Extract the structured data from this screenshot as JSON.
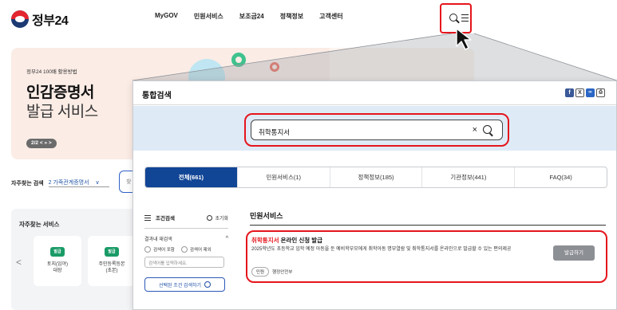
{
  "header": {
    "logo_text": "정부24",
    "menu": [
      "MyGOV",
      "민원서비스",
      "보조금24",
      "정책정보",
      "고객센터"
    ]
  },
  "hero": {
    "small": "정부24 100배 활용방법",
    "title": "인감증명서",
    "subtitle": "발급 서비스",
    "pager": "2/2 < » >"
  },
  "frequent_search": {
    "label": "자주찾는 검색",
    "selected": "2 가족관계증명서",
    "chevron": "∨",
    "input_prefix": "찾"
  },
  "frequent_services": {
    "title": "자주찾는 서비스",
    "prev_arrow": "<",
    "items": [
      {
        "badge": "발급",
        "name_line1": "토지(임야)",
        "name_line2": "대장"
      },
      {
        "badge": "발급",
        "name_line1": "주민등록등본",
        "name_line2": "(초본)"
      }
    ]
  },
  "popup": {
    "title": "통합검색",
    "share": {
      "facebook": "f",
      "x": "X",
      "link": "🔗",
      "print": "🖨"
    },
    "search_value": "취학통지서",
    "clear": "×",
    "tabs": [
      {
        "label": "전체(661)",
        "active": true
      },
      {
        "label": "민원서비스(1)",
        "active": false
      },
      {
        "label": "정책정보(185)",
        "active": false
      },
      {
        "label": "기관정보(441)",
        "active": false
      },
      {
        "label": "FAQ(34)",
        "active": false
      }
    ],
    "filter": {
      "title": "조건검색",
      "reset": "초기화",
      "sub_title": "결과내 재검색",
      "chevron": "^",
      "radio_include": "검색어 포함",
      "radio_exclude": "검색어 제외",
      "input_placeholder": "검색어를 입력하세요.",
      "apply": "선택된 조건 검색하기"
    },
    "results": {
      "heading": "민원서비스",
      "item": {
        "title_highlight": "취학통지서",
        "title_rest": " 온라인 신청 발급",
        "desc": "2025학년도 초등학교 입학 예정 아동을 둔 예비학부모에게 취학아동 명부열람 및 취학통지서를 온라인으로 발급할 수 있는 편의제공",
        "tag": "민원",
        "agency": "행정안전부",
        "button": "발급하기"
      }
    }
  },
  "colors": {
    "accent_red": "#e5151c",
    "navy": "#114596",
    "band": "#dfeaf7"
  }
}
